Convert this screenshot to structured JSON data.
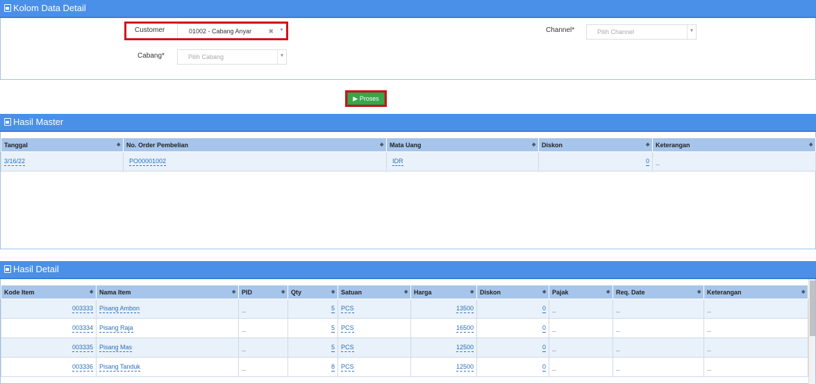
{
  "kolom": {
    "title": "Kolom Data Detail",
    "customer_label": "Customer",
    "customer_value": "01002 - Cabang Anyar",
    "channel_label": "Channel*",
    "channel_placeholder": "Pilih Channel",
    "cabang_label": "Cabang*",
    "cabang_placeholder": "Pilih Cabang"
  },
  "proses_label": "Proses",
  "master": {
    "title": "Hasil Master",
    "columns": [
      "Tanggal",
      "No. Order Pembelian",
      "Mata Uang",
      "Diskon",
      "Keterangan"
    ],
    "rows": [
      {
        "tanggal": "3/16/22",
        "no_order": "PO00001002",
        "mata_uang": "IDR",
        "diskon": "0",
        "keterangan": "--"
      }
    ]
  },
  "detail": {
    "title": "Hasil Detail",
    "columns": [
      "Kode Item",
      "Nama Item",
      "PID",
      "Qty",
      "Satuan",
      "Harga",
      "Diskon",
      "Pajak",
      "Req. Date",
      "Keterangan"
    ],
    "rows": [
      {
        "kode": "003333",
        "nama": "Pisang Ambon",
        "pid": "--",
        "qty": "5",
        "satuan": "PCS",
        "harga": "13500",
        "diskon": "0",
        "pajak": "--",
        "req_date": "--",
        "keterangan": "--"
      },
      {
        "kode": "003334",
        "nama": "Pisang Raja",
        "pid": "--",
        "qty": "5",
        "satuan": "PCS",
        "harga": "16500",
        "diskon": "0",
        "pajak": "--",
        "req_date": "--",
        "keterangan": "--"
      },
      {
        "kode": "003335",
        "nama": "Pisang Mas",
        "pid": "--",
        "qty": "5",
        "satuan": "PCS",
        "harga": "12500",
        "diskon": "0",
        "pajak": "--",
        "req_date": "--",
        "keterangan": "--"
      },
      {
        "kode": "003336",
        "nama": "Pisang Tanduk",
        "pid": "--",
        "qty": "8",
        "satuan": "PCS",
        "harga": "12500",
        "diskon": "0",
        "pajak": "--",
        "req_date": "--",
        "keterangan": "--"
      }
    ]
  },
  "colors": {
    "header_bg": "#4a90e8",
    "table_header_bg": "#a7c5ea",
    "proses_bg": "#3aa64b",
    "highlight": "#d0111b"
  }
}
